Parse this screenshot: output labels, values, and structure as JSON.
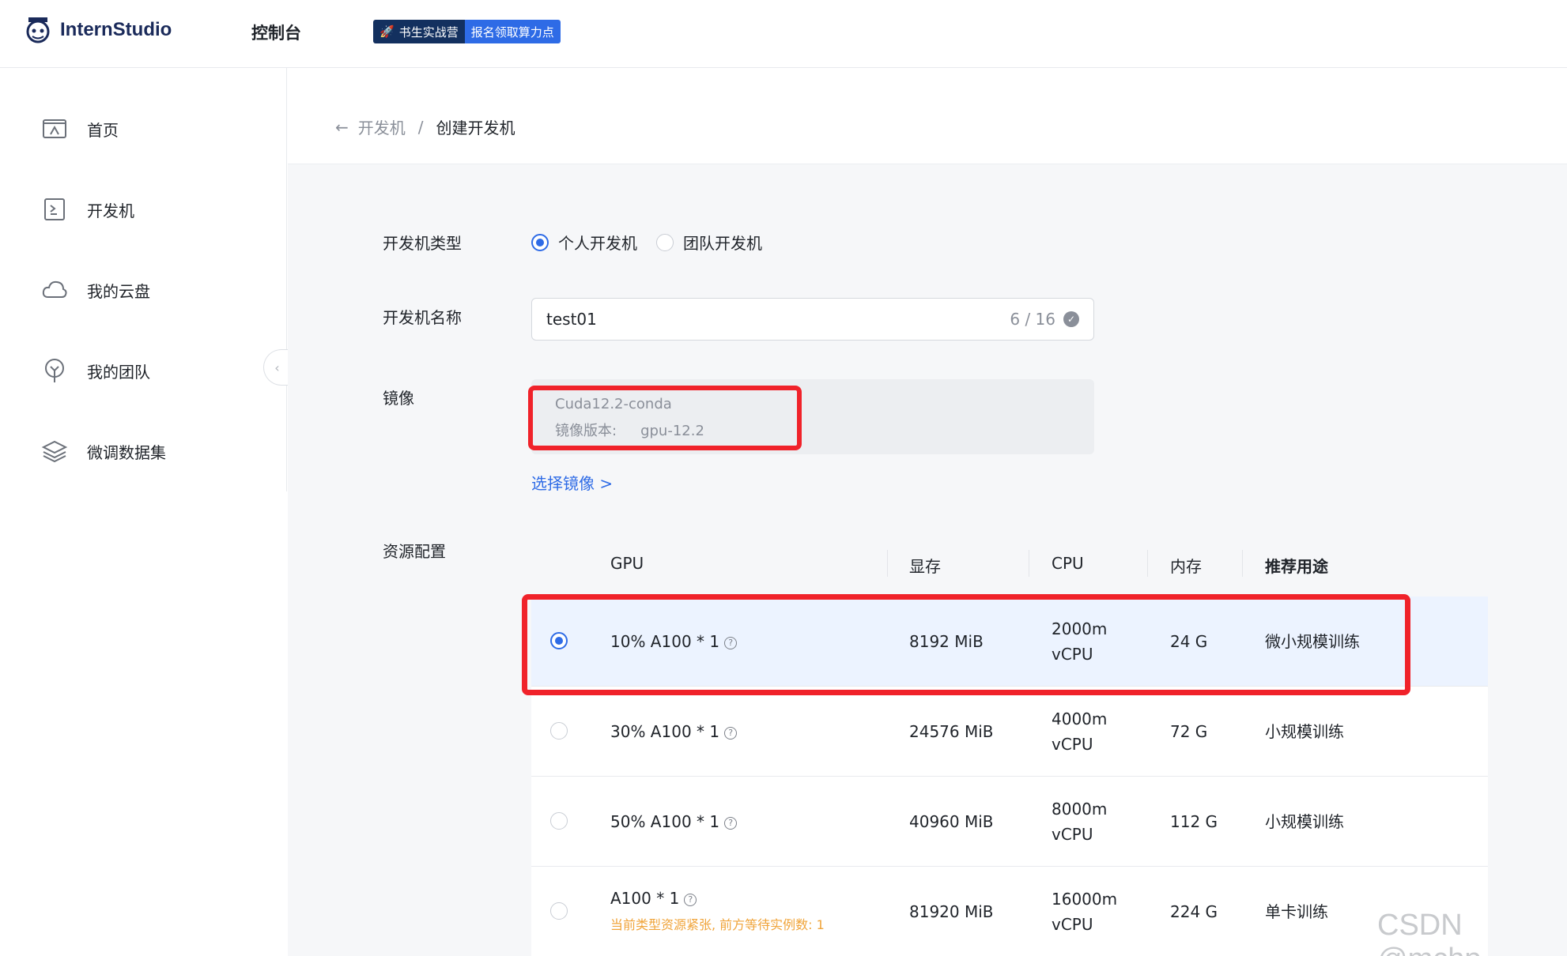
{
  "header": {
    "logo_text": "InternStudio",
    "console_label": "控制台",
    "banner_left": "书生实战营",
    "banner_right": "报名领取算力点"
  },
  "sidebar": {
    "items": [
      {
        "label": "首页",
        "icon": "home-icon"
      },
      {
        "label": "开发机",
        "icon": "terminal-icon"
      },
      {
        "label": "我的云盘",
        "icon": "cloud-icon"
      },
      {
        "label": "我的团队",
        "icon": "team-icon"
      },
      {
        "label": "微调数据集",
        "icon": "layers-icon"
      }
    ]
  },
  "breadcrumb": {
    "parent": "开发机",
    "separator": "/",
    "current": "创建开发机"
  },
  "form": {
    "type_label": "开发机类型",
    "type_options": [
      {
        "label": "个人开发机",
        "selected": true
      },
      {
        "label": "团队开发机",
        "selected": false
      }
    ],
    "name_label": "开发机名称",
    "name_value": "test01",
    "name_count": "6 / 16",
    "image_label": "镜像",
    "image_name": "Cuda12.2-conda",
    "image_version_label": "镜像版本:",
    "image_version_value": "gpu-12.2",
    "select_image_link": "选择镜像 >",
    "resource_label": "资源配置"
  },
  "resource_table": {
    "headers": [
      "GPU",
      "显存",
      "CPU",
      "内存",
      "推荐用途"
    ],
    "rows": [
      {
        "gpu": "10% A100 * 1",
        "vram": "8192 MiB",
        "cpu_line1": "2000m",
        "cpu_line2": "vCPU",
        "mem": "24 G",
        "usage": "微小规模训练",
        "selected": true,
        "warning": ""
      },
      {
        "gpu": "30% A100 * 1",
        "vram": "24576 MiB",
        "cpu_line1": "4000m",
        "cpu_line2": "vCPU",
        "mem": "72 G",
        "usage": "小规模训练",
        "selected": false,
        "warning": ""
      },
      {
        "gpu": "50% A100 * 1",
        "vram": "40960 MiB",
        "cpu_line1": "8000m",
        "cpu_line2": "vCPU",
        "mem": "112 G",
        "usage": "小规模训练",
        "selected": false,
        "warning": ""
      },
      {
        "gpu": "A100 * 1",
        "vram": "81920 MiB",
        "cpu_line1": "16000m",
        "cpu_line2": "vCPU",
        "mem": "224 G",
        "usage": "单卡训练",
        "selected": false,
        "warning": "当前类型资源紧张, 前方等待实例数: 1"
      }
    ]
  },
  "watermark": "CSDN @mchp",
  "colors": {
    "accent": "#2e6be6",
    "highlight": "#f0222a",
    "warning": "#f0a43a"
  }
}
